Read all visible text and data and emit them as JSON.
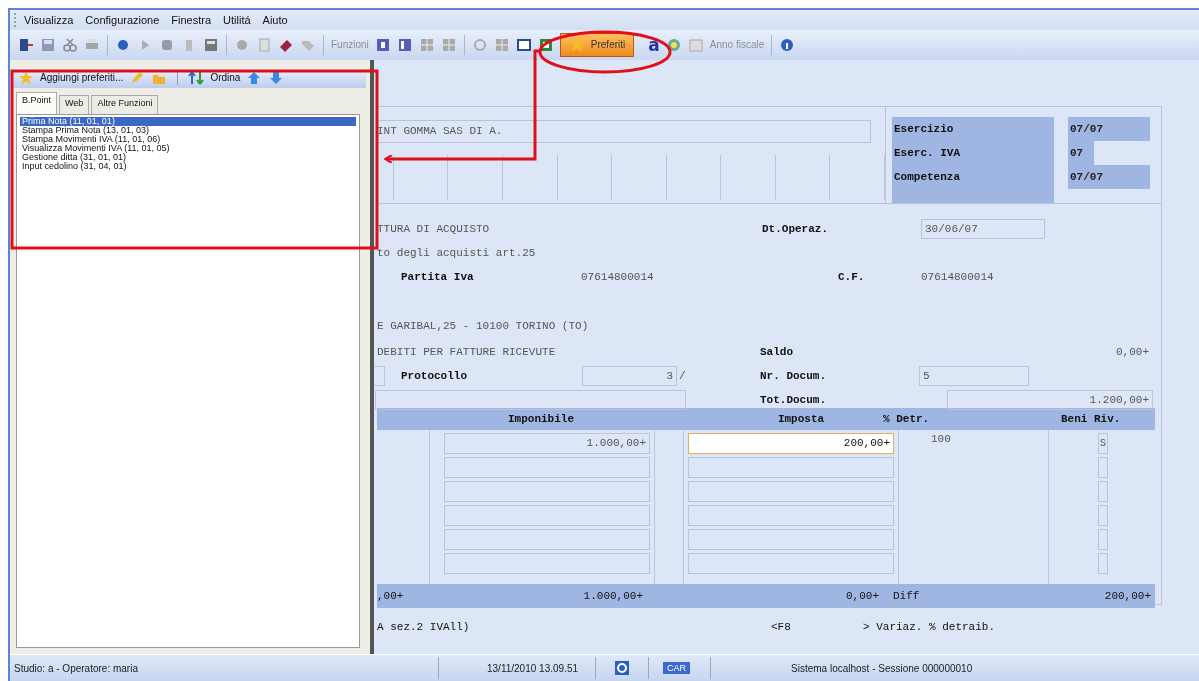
{
  "menu": [
    {
      "label": "Visualizza"
    },
    {
      "label": "Configurazione"
    },
    {
      "label": "Finestra"
    },
    {
      "label": "Utilitá"
    },
    {
      "label": "Aiuto"
    }
  ],
  "toolbar": {
    "functions_label": "Funzioni",
    "favorites_button": {
      "label": "Preferiti",
      "selected": true
    },
    "text_tool_glyph": "a",
    "fiscal_year_label": "Anno fiscale"
  },
  "favorites_panel": {
    "add_label": "Aggiungi preferiti...",
    "sort_label": "Ordina",
    "tabs": [
      {
        "label": "B.Point",
        "selected": true
      },
      {
        "label": "Web",
        "selected": false
      },
      {
        "label": "Altre Funzioni",
        "selected": false
      }
    ],
    "items": [
      {
        "label": "Prima Nota (11, 01, 01)",
        "selected": true
      },
      {
        "label": "Stampa Prima Nota (13, 01, 03)",
        "selected": false
      },
      {
        "label": "Stampa Movimenti IVA (11, 01, 06)",
        "selected": false
      },
      {
        "label": "Visualizza Movimenti IVA (11, 01, 05)",
        "selected": false
      },
      {
        "label": "Gestione ditta (31, 01, 01)",
        "selected": false
      },
      {
        "label": "Input cedolino (31, 04, 01)",
        "selected": false
      }
    ]
  },
  "form": {
    "company_name": "INT GOMMA SAS DI A.",
    "period": [
      {
        "label": "Esercizio",
        "value": "07/07"
      },
      {
        "label": "Eserc. IVA",
        "value": "07"
      },
      {
        "label": "Competenza",
        "value": "07/07"
      }
    ],
    "document_type": "TTURA DI ACQUISTO",
    "operation_date": {
      "label": "Dt.Operaz.",
      "value": "30/06/07"
    },
    "register_note": "to degli acquisti art.25",
    "vat_number": {
      "label": "Partita Iva",
      "value": "07614800014"
    },
    "tax_code": {
      "label": "C.F.",
      "value": "07614800014"
    },
    "address": "E GARIBAL,25 - 10100 TORINO (TO)",
    "account": "DEBITI PER FATTURE RICEVUTE",
    "balance": {
      "label": "Saldo",
      "value": "0,00+"
    },
    "protocol": {
      "label": "Protocollo",
      "value": "3",
      "separator": "/"
    },
    "doc_number": {
      "label": "Nr. Docum.",
      "value": "5"
    },
    "doc_total": {
      "label": "Tot.Docum.",
      "value": "1.200,00+"
    },
    "table": {
      "columns": [
        "Imponibile",
        "Imposta",
        "% Detr.",
        "Beni Riv."
      ],
      "rows": [
        {
          "imponibile": "1.000,00+",
          "imposta": "200,00+",
          "detr": "100",
          "beni_riv": "S",
          "focused": true
        },
        {
          "focused": false
        },
        {
          "focused": false
        },
        {
          "focused": false
        },
        {
          "focused": false
        },
        {
          "focused": false
        }
      ]
    },
    "totals": {
      "column_1": ",00+",
      "imponibile": "1.000,00+",
      "imposta": "0,00+",
      "diff_label": "Diff",
      "diff": "200,00+"
    },
    "footer": {
      "note": "A sez.2 IVAll)",
      "key": "<F8",
      "action": "> Variaz. % detraib."
    }
  },
  "status_bar": {
    "user": "Studio: a - Operatore: maria",
    "datetime": "13/11/2010 13.09.51",
    "keyboard": "CAR",
    "session": "Sistema localhost - Sessione 000000010"
  }
}
